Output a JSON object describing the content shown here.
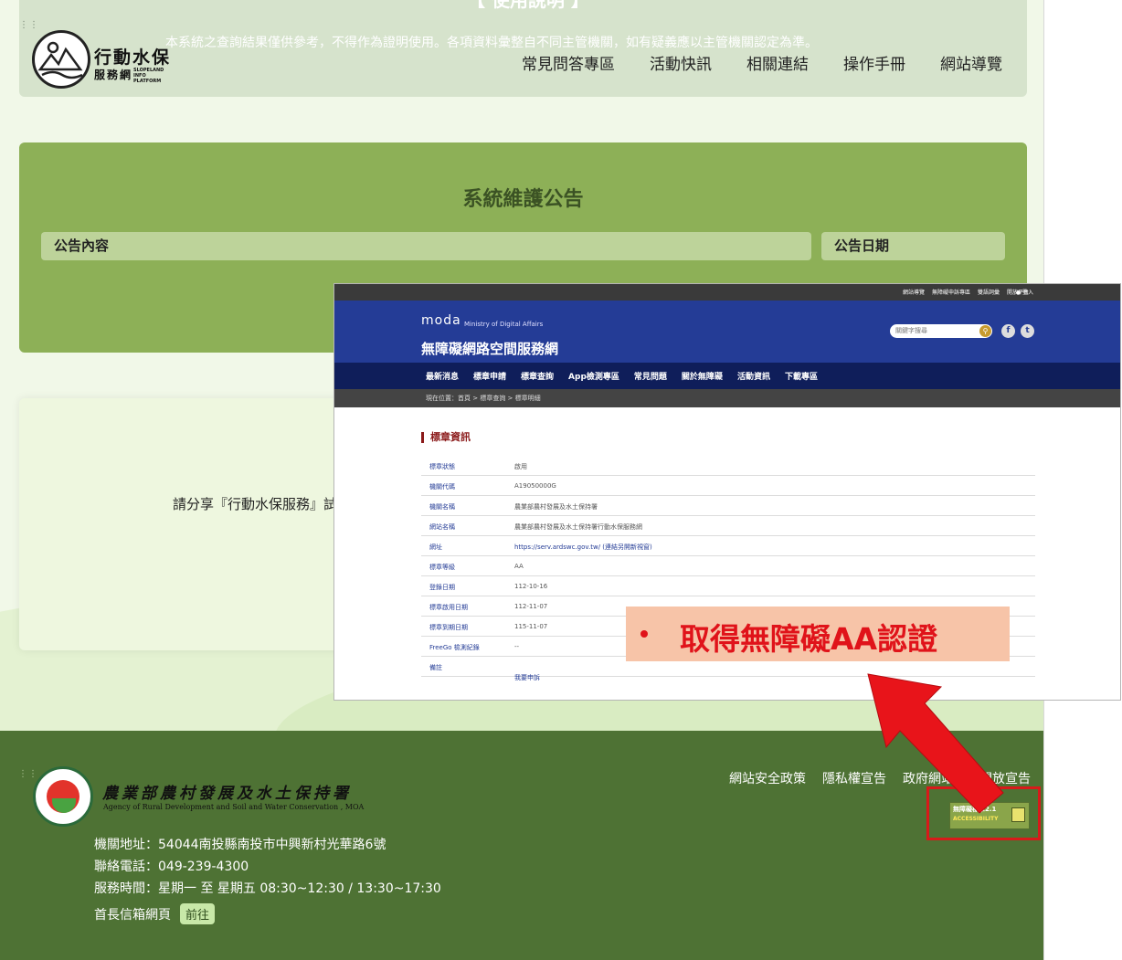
{
  "header": {
    "notice_top": "【 使用說明 】",
    "notice": "本系統之查詢結果僅供參考，不得作為證明使用。各項資料彙整自不同主管機關，如有疑義應以主管機關認定為準。",
    "logo_title": "行動水保",
    "logo_subtitle": "服務網",
    "logo_en": "SLOPELAND INFO PLATFORM",
    "nav": [
      "常見問答專區",
      "活動快訊",
      "相關連結",
      "操作手冊",
      "網站導覽"
    ]
  },
  "maintenance": {
    "title": "系統維護公告",
    "col_content": "公告內容",
    "col_date": "公告日期"
  },
  "share": {
    "text": "請分享『行動水保服務』試"
  },
  "footer": {
    "agency_name": "農業部農村發展及水土保持署",
    "agency_en": "Agency of Rural Development and Soil and Water Conservation , MOA",
    "address": "機關地址：54044南投縣南投市中興新村光華路6號",
    "phone": "聯絡電話：049-239-4300",
    "hours": "服務時間：星期一 至 星期五 08:30~12:30 / 13:30~17:30",
    "mailbox": "首長信箱網頁",
    "mailbox_btn": "前往",
    "links": [
      "網站安全政策",
      "隱私權宣告",
      "政府網站資料開放宣告"
    ],
    "badge_line1": "無障礙標章2.1",
    "badge_line2": "ACCESSIBILITY"
  },
  "inset": {
    "topbar_links": [
      "網站導覽",
      "無障礙申訴專區",
      "雙語詞彙",
      "開放平台"
    ],
    "login": "登入",
    "moda_logo": "moda",
    "moda_en": "Ministry of Digital Affairs",
    "site_title": "無障礙網路空間服務網",
    "search_placeholder": "關鍵字搜尋",
    "nav": [
      "最新消息",
      "標章申請",
      "標章查詢",
      "App檢測專區",
      "常見問題",
      "關於無障礙",
      "活動資訊",
      "下載專區"
    ],
    "breadcrumb": "現在位置：首頁 > 標章查詢 > 標章明細",
    "section_title": "標章資訊",
    "rows": [
      {
        "k": "標章狀態",
        "v": "啟用"
      },
      {
        "k": "機關代碼",
        "v": "A19050000G"
      },
      {
        "k": "機關名稱",
        "v": "農業部農村發展及水土保持署"
      },
      {
        "k": "網站名稱",
        "v": "農業部農村發展及水土保持署行動水保服務網"
      },
      {
        "k": "網址",
        "v": "https://serv.ardswc.gov.tw/ (連結另開新視窗)"
      },
      {
        "k": "標章等級",
        "v": "AA"
      },
      {
        "k": "登錄日期",
        "v": "112-10-16"
      },
      {
        "k": "標章啟用日期",
        "v": "112-11-07"
      },
      {
        "k": "標章到期日期",
        "v": "115-11-07"
      },
      {
        "k": "FreeGo 檢測紀錄",
        "v": "--"
      },
      {
        "k": "備註",
        "v": ""
      }
    ],
    "apply_link": "我要申訴"
  },
  "callout": {
    "text": "取得無障礙AA認證"
  },
  "colors": {
    "accent_red": "#e0131a",
    "footer_green": "#4e7234",
    "moda_blue": "#243c96"
  }
}
